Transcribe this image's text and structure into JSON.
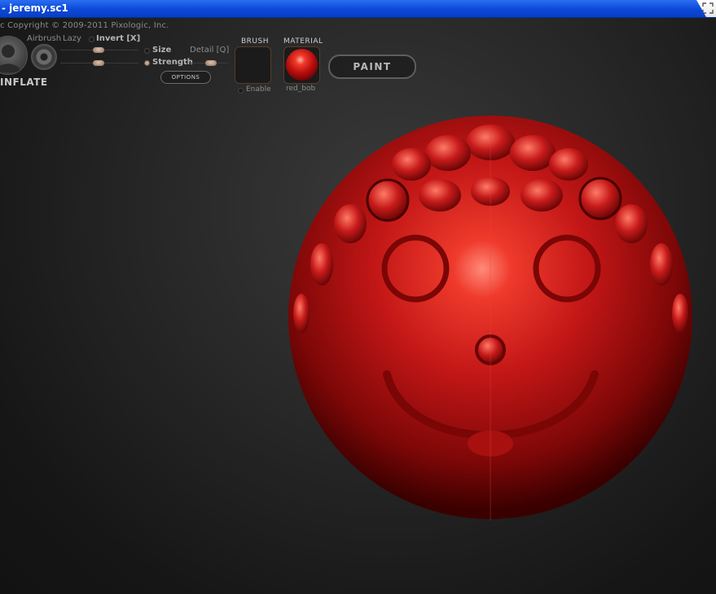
{
  "window": {
    "title": "- jeremy.sc1"
  },
  "copyright": "c   Copyright © 2009-2011 Pixologic, Inc.",
  "brush_tool": {
    "name": "INFLATE",
    "airbrush_label": "Airbrush",
    "lazy_label": "Lazy",
    "invert_label": "Invert [X]",
    "size_label": "Size",
    "strength_label": "Strength",
    "detail_label": "Detail [Q]",
    "options_label": "OPTIONS"
  },
  "brush": {
    "label": "BRUSH",
    "enable_label": "Enable"
  },
  "material": {
    "label": "MATERIAL",
    "name": "red_bob",
    "color": "#c41414"
  },
  "paint_button": {
    "label": "PAINT"
  },
  "icons": [
    "expand-icon",
    "avatar-icon",
    "ring-brush-icon"
  ]
}
